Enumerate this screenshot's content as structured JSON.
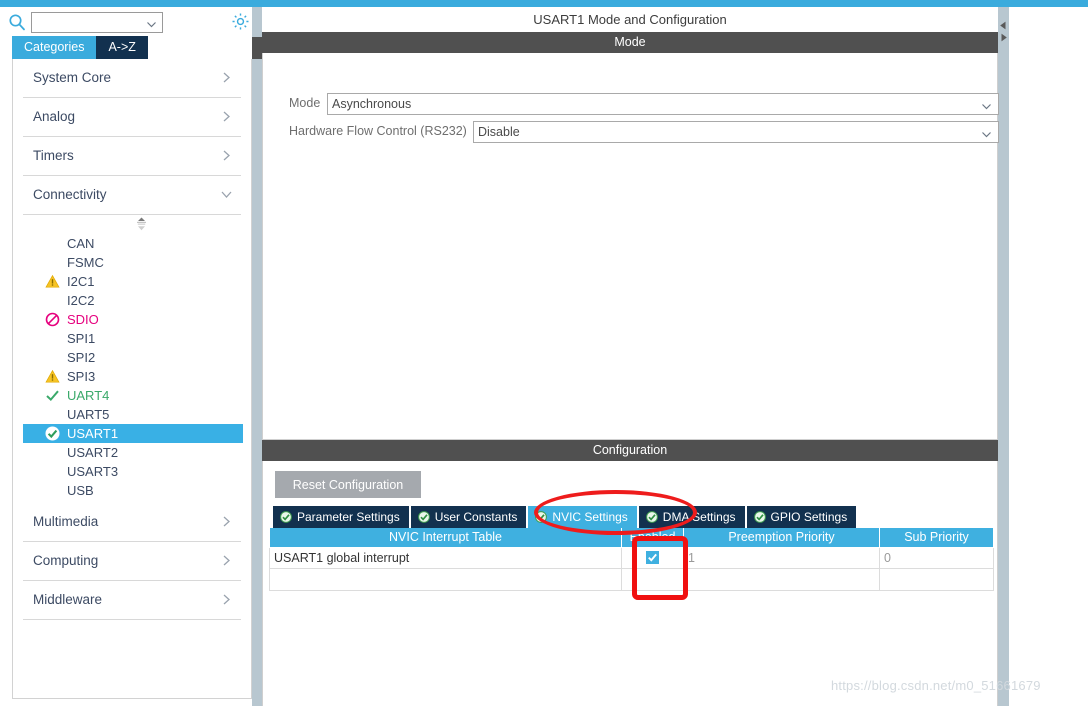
{
  "theme": {
    "accent_blue": "#3aabdd",
    "tab_navy": "#12314f",
    "table_header_blue": "#3fb0e0",
    "bar_dark": "#505050",
    "annotation_red": "#ee1c1c",
    "selected_row_blue": "#39b0e5",
    "ok_green": "#3aa96a",
    "warn_yellow": "#f2c200",
    "block_pink": "#e6007e"
  },
  "sidebar": {
    "search": {
      "value": "",
      "placeholder": ""
    },
    "search_icon": "search-icon",
    "gear_icon": "gear-icon",
    "tabs": [
      {
        "label": "Categories",
        "active": true
      },
      {
        "label": "A->Z",
        "active": false
      }
    ],
    "categories_top": [
      {
        "label": "System Core",
        "expanded": false,
        "chevron": "chevron-right-icon"
      },
      {
        "label": "Analog",
        "expanded": false,
        "chevron": "chevron-right-icon"
      },
      {
        "label": "Timers",
        "expanded": false,
        "chevron": "chevron-right-icon"
      },
      {
        "label": "Connectivity",
        "expanded": true,
        "chevron": "chevron-down-icon"
      }
    ],
    "peripherals": [
      {
        "label": "CAN",
        "status": "none",
        "selected": false
      },
      {
        "label": "FSMC",
        "status": "none",
        "selected": false
      },
      {
        "label": "I2C1",
        "status": "warning",
        "selected": false
      },
      {
        "label": "I2C2",
        "status": "none",
        "selected": false
      },
      {
        "label": "SDIO",
        "status": "blocked",
        "selected": false
      },
      {
        "label": "SPI1",
        "status": "none",
        "selected": false
      },
      {
        "label": "SPI2",
        "status": "none",
        "selected": false
      },
      {
        "label": "SPI3",
        "status": "warning",
        "selected": false
      },
      {
        "label": "UART4",
        "status": "ok",
        "selected": false
      },
      {
        "label": "UART5",
        "status": "none",
        "selected": false
      },
      {
        "label": "USART1",
        "status": "ok-selected",
        "selected": true
      },
      {
        "label": "USART2",
        "status": "none",
        "selected": false
      },
      {
        "label": "USART3",
        "status": "none",
        "selected": false
      },
      {
        "label": "USB",
        "status": "none",
        "selected": false
      }
    ],
    "categories_bottom": [
      {
        "label": "Multimedia",
        "expanded": false,
        "chevron": "chevron-right-icon"
      },
      {
        "label": "Computing",
        "expanded": false,
        "chevron": "chevron-right-icon"
      },
      {
        "label": "Middleware",
        "expanded": false,
        "chevron": "chevron-right-icon"
      }
    ]
  },
  "main": {
    "panel_title": "USART1 Mode and Configuration",
    "mode_section": {
      "header": "Mode",
      "fields": [
        {
          "label": "Mode",
          "value": "Asynchronous"
        },
        {
          "label": "Hardware Flow Control (RS232)",
          "value": "Disable"
        }
      ]
    },
    "configuration_section": {
      "header": "Configuration",
      "reset_button": "Reset Configuration",
      "tabs": [
        {
          "label": "Parameter Settings",
          "active": false,
          "icon": "green-check-icon"
        },
        {
          "label": "User Constants",
          "active": false,
          "icon": "green-check-icon"
        },
        {
          "label": "NVIC Settings",
          "active": true,
          "icon": "green-check-icon"
        },
        {
          "label": "DMA Settings",
          "active": false,
          "icon": "green-check-icon"
        },
        {
          "label": "GPIO Settings",
          "active": false,
          "icon": "green-check-icon"
        }
      ],
      "nvic_table": {
        "columns": [
          "NVIC Interrupt Table",
          "Enabled",
          "Preemption Priority",
          "Sub Priority"
        ],
        "rows": [
          {
            "interrupt": "USART1 global interrupt",
            "enabled": true,
            "preemption_priority": "1",
            "sub_priority": "0"
          }
        ]
      }
    }
  },
  "annotations": {
    "ellipse_target": "NVIC Settings",
    "rect_target": "Enabled checkbox"
  },
  "watermark": "https://blog.csdn.net/m0_51661679"
}
